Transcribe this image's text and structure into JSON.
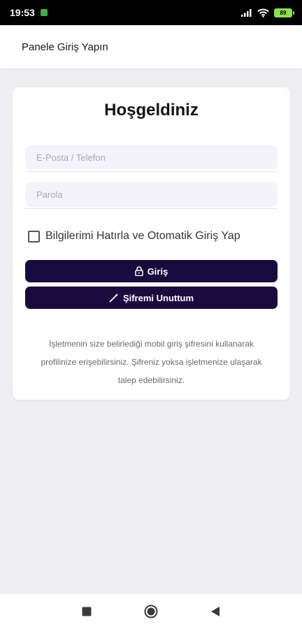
{
  "status_bar": {
    "time": "19:53",
    "battery": "89",
    "icons": [
      "signal-icon",
      "wifi-icon",
      "battery-icon"
    ]
  },
  "header": {
    "title": "Panele Giriş Yapın"
  },
  "card": {
    "title": "Hoşgeldiniz",
    "email_placeholder": "E-Posta / Telefon",
    "password_placeholder": "Parola",
    "remember_label": "Bilgilerimi Hatırla ve Otomatik Giriş Yap",
    "remember_checked": false,
    "login_button": "Giriş",
    "forgot_button": "Şifremi Unuttum",
    "info_text": "İşletmenin size belirlediği mobil giriş şifresini kullanarak profilinize erişebilirsiniz. Şifreniz yoksa işletmenize ulaşarak talep edebilirsiniz."
  },
  "colors": {
    "button_bg": "#1b0a3d",
    "page_bg": "#efeef3",
    "input_bg": "#f4f3fc"
  },
  "nav": {
    "icons": [
      "recent-apps-icon",
      "home-icon",
      "back-icon"
    ]
  }
}
